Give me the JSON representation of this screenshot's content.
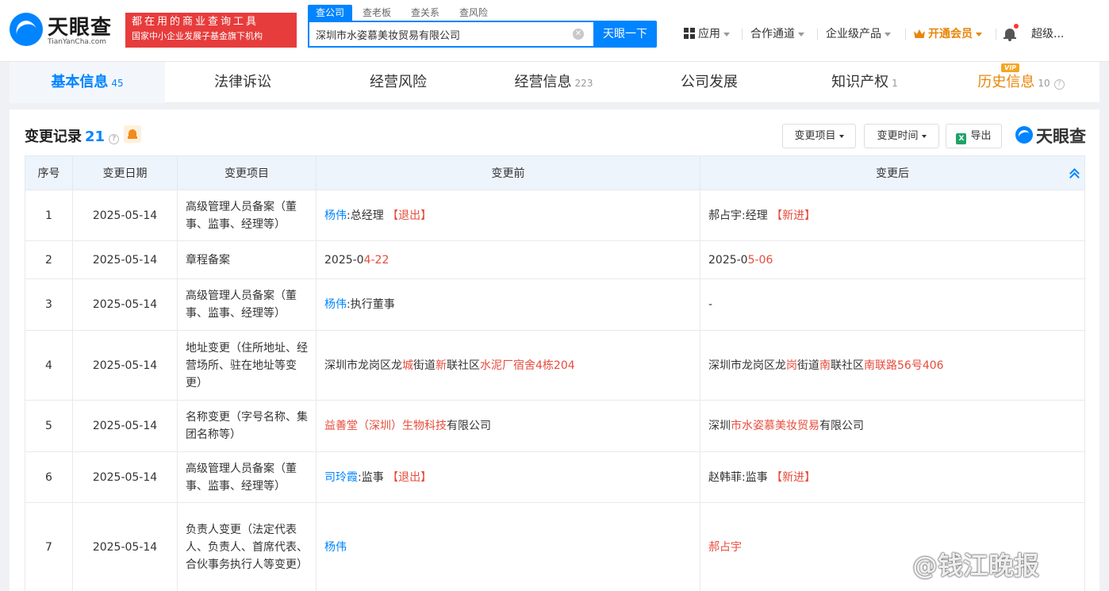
{
  "header": {
    "logo_cn": "天眼查",
    "logo_en": "TianYanCha.com",
    "slogan1": "都在用的商业查询工具",
    "slogan2": "国家中小企业发展子基金旗下机构",
    "search_tabs": [
      "查公司",
      "查老板",
      "查关系",
      "查风险"
    ],
    "search_value": "深圳市水姿慕美妆贸易有限公司",
    "search_button": "天眼一下",
    "nav": {
      "apps": "应用",
      "partner": "合作通道",
      "enterprise": "企业级产品",
      "vip": "开通会员",
      "user": "超级..."
    }
  },
  "tabs": [
    {
      "label": "基本信息",
      "count": "45"
    },
    {
      "label": "法律诉讼",
      "count": ""
    },
    {
      "label": "经营风险",
      "count": ""
    },
    {
      "label": "经营信息",
      "count": "223"
    },
    {
      "label": "公司发展",
      "count": ""
    },
    {
      "label": "知识产权",
      "count": "1"
    },
    {
      "label": "历史信息",
      "count": "10",
      "badge": "VIP"
    }
  ],
  "section": {
    "title": "变更记录",
    "count": "21",
    "filter_item": "变更项目",
    "filter_time": "变更时间",
    "export": "导出",
    "brand": "天眼查"
  },
  "table": {
    "headers": [
      "序号",
      "变更日期",
      "变更项目",
      "变更前",
      "变更后"
    ],
    "rows": [
      {
        "no": "1",
        "date": "2025-05-14",
        "item": "高级管理人员备案（董事、监事、经理等）",
        "before": [
          {
            "t": "杨伟",
            "c": "blue"
          },
          {
            "t": ":总经理 "
          },
          {
            "t": "【退出】",
            "c": "red"
          }
        ],
        "after": [
          {
            "t": "郝占宇:经理 "
          },
          {
            "t": "【新进】",
            "c": "red"
          }
        ]
      },
      {
        "no": "2",
        "date": "2025-05-14",
        "item": "章程备案",
        "before": [
          {
            "t": "2025-0"
          },
          {
            "t": "4-22",
            "c": "red"
          }
        ],
        "after": [
          {
            "t": "2025-0"
          },
          {
            "t": "5-06",
            "c": "red"
          }
        ]
      },
      {
        "no": "3",
        "date": "2025-05-14",
        "item": "高级管理人员备案（董事、监事、经理等）",
        "before": [
          {
            "t": "杨伟",
            "c": "blue"
          },
          {
            "t": ":执行董事"
          }
        ],
        "after": [
          {
            "t": "-"
          }
        ]
      },
      {
        "no": "4",
        "date": "2025-05-14",
        "item": "地址变更（住所地址、经营场所、驻在地址等变更）",
        "before": [
          {
            "t": "深圳市龙岗区龙"
          },
          {
            "t": "城",
            "c": "red"
          },
          {
            "t": "街道"
          },
          {
            "t": "新",
            "c": "red"
          },
          {
            "t": "联社区"
          },
          {
            "t": "水泥厂宿舍4栋204",
            "c": "red"
          }
        ],
        "after": [
          {
            "t": "深圳市龙岗区龙"
          },
          {
            "t": "岗",
            "c": "red"
          },
          {
            "t": "街道"
          },
          {
            "t": "南",
            "c": "red"
          },
          {
            "t": "联社区"
          },
          {
            "t": "南联路56号406",
            "c": "red"
          }
        ]
      },
      {
        "no": "5",
        "date": "2025-05-14",
        "item": "名称变更（字号名称、集团名称等）",
        "before": [
          {
            "t": "益善堂（深圳）生物科技",
            "c": "red"
          },
          {
            "t": "有限公司"
          }
        ],
        "after": [
          {
            "t": "深圳"
          },
          {
            "t": "市水姿慕美妆贸易",
            "c": "red"
          },
          {
            "t": "有限公司"
          }
        ]
      },
      {
        "no": "6",
        "date": "2025-05-14",
        "item": "高级管理人员备案（董事、监事、经理等）",
        "before": [
          {
            "t": "司玲霞",
            "c": "blue"
          },
          {
            "t": ":监事 "
          },
          {
            "t": "【退出】",
            "c": "red"
          }
        ],
        "after": [
          {
            "t": "赵韩菲:监事 "
          },
          {
            "t": "【新进】",
            "c": "red"
          }
        ]
      },
      {
        "no": "7",
        "date": "2025-05-14",
        "item": "负责人变更（法定代表人、负责人、首席代表、合伙事务执行人等变更）",
        "before": [
          {
            "t": "杨伟",
            "c": "blue"
          }
        ],
        "after": [
          {
            "t": "郝占宇",
            "c": "red"
          }
        ]
      }
    ]
  },
  "watermark": "@钱江晚报"
}
